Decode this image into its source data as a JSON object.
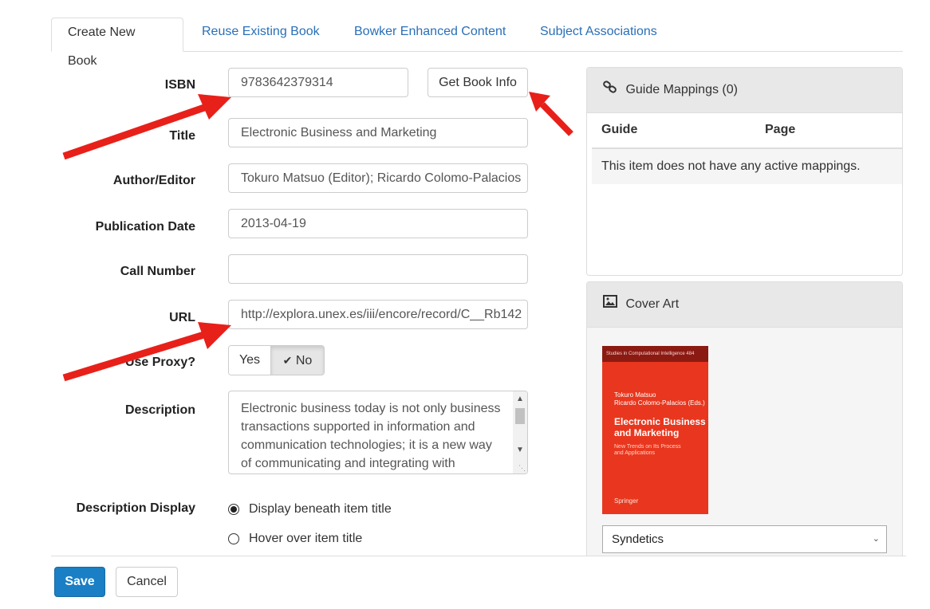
{
  "tabs": [
    {
      "label": "Create New Book",
      "active": true
    },
    {
      "label": "Reuse Existing Book"
    },
    {
      "label": "Bowker Enhanced Content"
    },
    {
      "label": "Subject Associations"
    }
  ],
  "form": {
    "isbn_label": "ISBN",
    "isbn_value": "9783642379314",
    "get_book_info": "Get Book Info",
    "title_label": "Title",
    "title_value": "Electronic Business and Marketing",
    "author_label": "Author/Editor",
    "author_value": "Tokuro Matsuo (Editor); Ricardo Colomo-Palacios",
    "pubdate_label": "Publication Date",
    "pubdate_value": "2013-04-19",
    "callnum_label": "Call Number",
    "callnum_value": "",
    "url_label": "URL",
    "url_value": "http://explora.unex.es/iii/encore/record/C__Rb142",
    "proxy_label": "Use Proxy?",
    "proxy_yes": "Yes",
    "proxy_no": "No",
    "description_label": "Description",
    "description_value": "Electronic business today is not only business transactions supported in information and communication technologies; it is a new way of communicating and integrating with",
    "desc_display_label": "Description Display",
    "desc_display_options": [
      "Display beneath item title",
      "Hover over item title"
    ],
    "desc_display_selected": 0
  },
  "guide_mappings": {
    "title": "Guide Mappings (0)",
    "col_guide": "Guide",
    "col_page": "Page",
    "empty_message": "This item does not have any active mappings."
  },
  "cover_art": {
    "title": "Cover Art",
    "cover_series": "Studies in Computational Intelligence   484",
    "cover_authors": "Tokuro Matsuo\nRicardo Colomo-Palacios (Eds.)",
    "cover_title": "Electronic Business\nand Marketing",
    "cover_subtitle": "New Trends on Its Process\nand Applications",
    "cover_publisher": "Springer",
    "source_selected": "Syndetics"
  },
  "footer": {
    "save": "Save",
    "cancel": "Cancel"
  },
  "colors": {
    "link": "#2a6fb8",
    "primary": "#1a7fc4",
    "arrow": "#e8201a"
  }
}
